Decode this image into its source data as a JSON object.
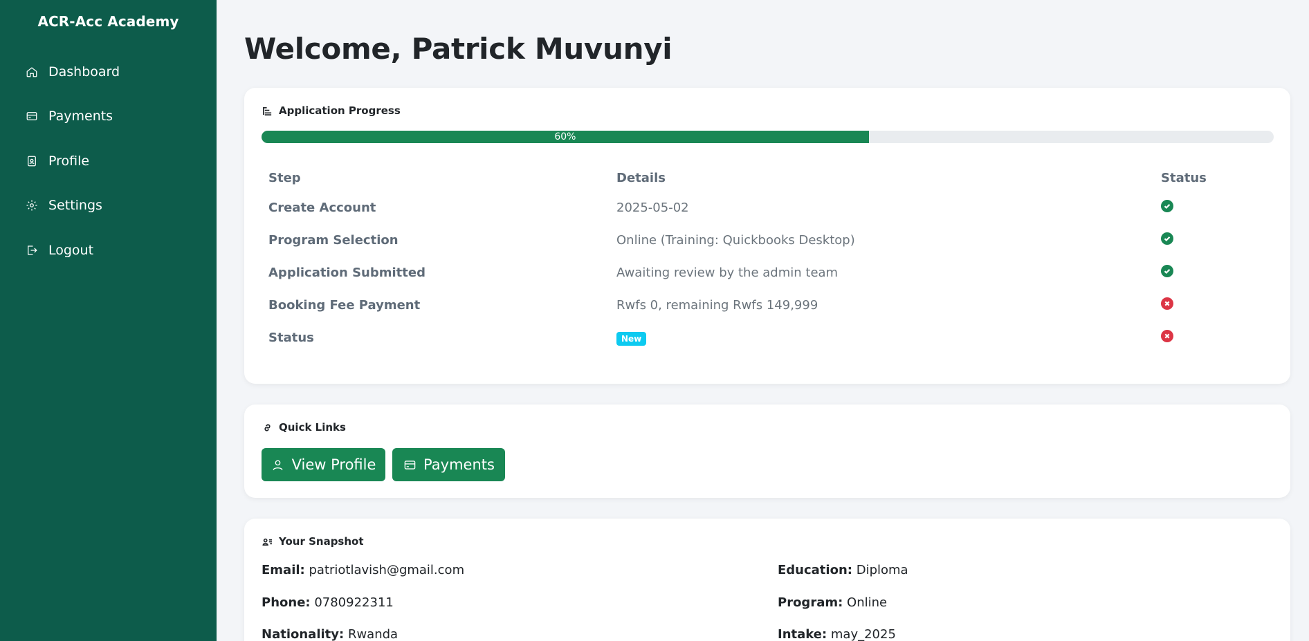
{
  "sidebar": {
    "brand": "ACR-Acc Academy",
    "items": [
      {
        "label": "Dashboard",
        "icon": "home-icon"
      },
      {
        "label": "Payments",
        "icon": "credit-card-icon"
      },
      {
        "label": "Profile",
        "icon": "id-badge-icon"
      },
      {
        "label": "Settings",
        "icon": "gear-icon"
      },
      {
        "label": "Logout",
        "icon": "logout-icon"
      }
    ]
  },
  "welcome": "Welcome, Patrick Muvunyi",
  "progress": {
    "title": "Application Progress",
    "percent_label": "60%",
    "percent": 0.6,
    "headers": {
      "step": "Step",
      "details": "Details",
      "status": "Status"
    },
    "rows": [
      {
        "step": "Create Account",
        "details": "2025-05-02",
        "status": "complete"
      },
      {
        "step": "Program Selection",
        "details": "Online (Training: Quickbooks Desktop)",
        "status": "complete"
      },
      {
        "step": "Application Submitted",
        "details": "Awaiting review by the admin team",
        "status": "complete"
      },
      {
        "step": "Booking Fee Payment",
        "details": "Rwfs 0, remaining Rwfs 149,999",
        "status": "incomplete"
      },
      {
        "step": "Status",
        "details_badge": "New",
        "status": "incomplete"
      }
    ]
  },
  "quick_links": {
    "title": "Quick Links",
    "view_profile": "View Profile",
    "payments": "Payments"
  },
  "snapshot": {
    "title": "Your Snapshot",
    "email_label": "Email:",
    "email": "patriotlavish@gmail.com",
    "phone_label": "Phone:",
    "phone": "0780922311",
    "nationality_label": "Nationality:",
    "nationality": "Rwanda",
    "education_label": "Education:",
    "education": "Diploma",
    "program_label": "Program:",
    "program": "Online",
    "intake_label": "Intake:",
    "intake": "may_2025"
  },
  "colors": {
    "sidebar": "#0d5c4b",
    "accent": "#198754",
    "danger": "#dc3545",
    "info_badge": "#0dcaf0"
  }
}
